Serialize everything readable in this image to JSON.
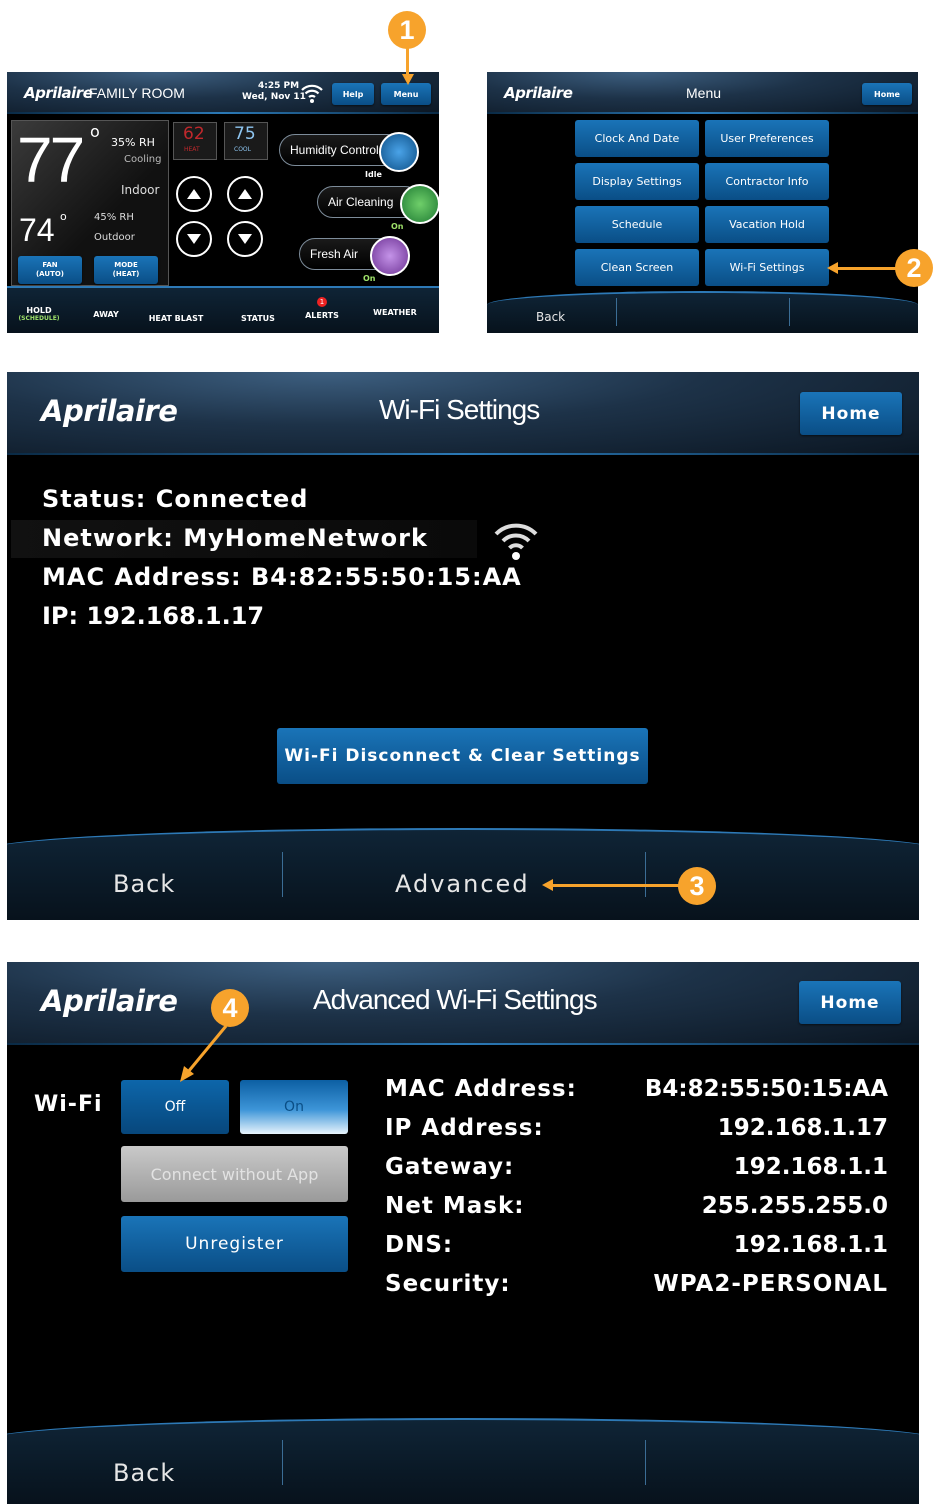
{
  "screen1": {
    "logo": "Aprilaire",
    "room": "FAMILY ROOM",
    "time": "4:25 PM",
    "date": "Wed, Nov 11",
    "help_label": "Help",
    "menu_label": "Menu",
    "indoor_temp": "77",
    "indoor_rh": "35% RH",
    "cooling_label": "Cooling",
    "indoor_label": "Indoor",
    "outdoor_temp": "74",
    "outdoor_rh": "45% RH",
    "outdoor_label": "Outdoor",
    "heat_set": "62",
    "heat_label": "HEAT",
    "cool_set": "75",
    "cool_label": "COOL",
    "fan_label": "FAN",
    "fan_sub": "(AUTO)",
    "mode_label": "MODE",
    "mode_sub": "(HEAT)",
    "humidity_label": "Humidity Control",
    "humidity_status": "Idle",
    "air_cleaning_label": "Air Cleaning",
    "air_cleaning_status": "On",
    "fresh_air_label": "Fresh Air",
    "fresh_air_status": "On",
    "bottom": {
      "hold": "HOLD",
      "hold_sub": "(SCHEDULE)",
      "away": "AWAY",
      "heat_blast": "HEAT BLAST",
      "status": "STATUS",
      "alerts": "ALERTS",
      "alerts_count": "1",
      "weather": "WEATHER"
    }
  },
  "screen2": {
    "logo": "Aprilaire",
    "title": "Menu",
    "home_label": "Home",
    "items": [
      "Clock And Date",
      "User Preferences",
      "Display Settings",
      "Contractor Info",
      "Schedule",
      "Vacation Hold",
      "Clean Screen",
      "Wi-Fi Settings"
    ],
    "back_label": "Back"
  },
  "screen3": {
    "logo": "Aprilaire",
    "title": "Wi-Fi Settings",
    "home_label": "Home",
    "status": "Status: Connected",
    "network": "Network: MyHomeNetwork",
    "mac": "MAC Address: B4:82:55:50:15:AA",
    "ip": "IP: 192.168.1.17",
    "disconnect_label": "Wi-Fi Disconnect & Clear Settings",
    "back_label": "Back",
    "advanced_label": "Advanced"
  },
  "screen4": {
    "logo": "Aprilaire",
    "title": "Advanced Wi-Fi Settings",
    "home_label": "Home",
    "wifi_label": "Wi-Fi",
    "off_label": "Off",
    "on_label": "On",
    "connect_label": "Connect without App",
    "unregister_label": "Unregister",
    "rows": [
      {
        "label": "MAC Address:",
        "value": "B4:82:55:50:15:AA"
      },
      {
        "label": "IP Address:",
        "value": "192.168.1.17"
      },
      {
        "label": "Gateway:",
        "value": "192.168.1.1"
      },
      {
        "label": "Net Mask:",
        "value": "255.255.255.0"
      },
      {
        "label": "DNS:",
        "value": "192.168.1.1"
      },
      {
        "label": "Security:",
        "value": "WPA2-PERSONAL"
      }
    ],
    "back_label": "Back"
  },
  "callouts": [
    "1",
    "2",
    "3",
    "4"
  ],
  "colors": {
    "accent": "#f7a32c",
    "button": "#0a5a96",
    "background": "#000000"
  }
}
